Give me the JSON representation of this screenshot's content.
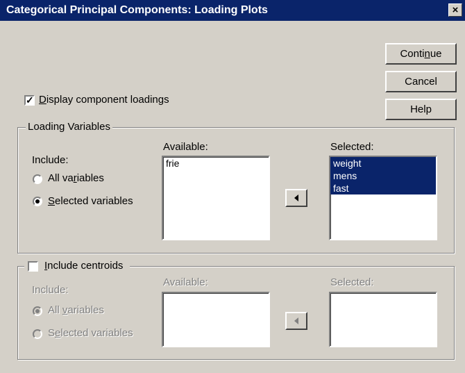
{
  "window": {
    "title": "Categorical Principal Components: Loading Plots",
    "close_label": "×"
  },
  "buttons": {
    "continue": "Continue",
    "cancel": "Cancel",
    "help": "Help"
  },
  "display_loadings": {
    "label": "Display component loadings",
    "checked": true
  },
  "loading_variables": {
    "group_label": "Loading Variables",
    "include_label": "Include:",
    "options": [
      "All variables",
      "Selected variables"
    ],
    "selected_option": "Selected variables",
    "available_label": "Available:",
    "available_items": [
      "frie"
    ],
    "selected_label": "Selected:",
    "selected_items": [
      "weight",
      "mens",
      "fast"
    ]
  },
  "centroids": {
    "label": "Include centroids",
    "checked": false,
    "include_label": "Include:",
    "options": [
      "All variables",
      "Selected variables"
    ],
    "selected_option": "All variables",
    "available_label": "Available:",
    "available_items": [],
    "selected_label": "Selected:",
    "selected_items": []
  }
}
